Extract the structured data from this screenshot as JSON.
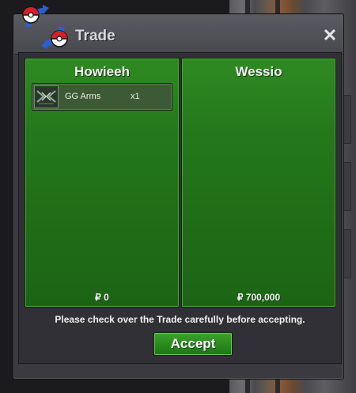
{
  "window": {
    "title": "Trade",
    "close_label": "✕"
  },
  "panels": [
    {
      "name": "Howieeh",
      "items": [
        {
          "name": "GG Arms",
          "qty": "x1",
          "icon": "gg-arms-item-icon"
        }
      ],
      "money": "₽ 0"
    },
    {
      "name": "Wessio",
      "items": [],
      "money": "₽ 700,000"
    }
  ],
  "notice": "Please check over the Trade carefully before accepting.",
  "accept_label": "Accept",
  "colors": {
    "panel_green": "#24781a",
    "window_gray": "#3a3a40",
    "accent_red": "#d61f2a",
    "accent_blue": "#2a5fcf"
  }
}
